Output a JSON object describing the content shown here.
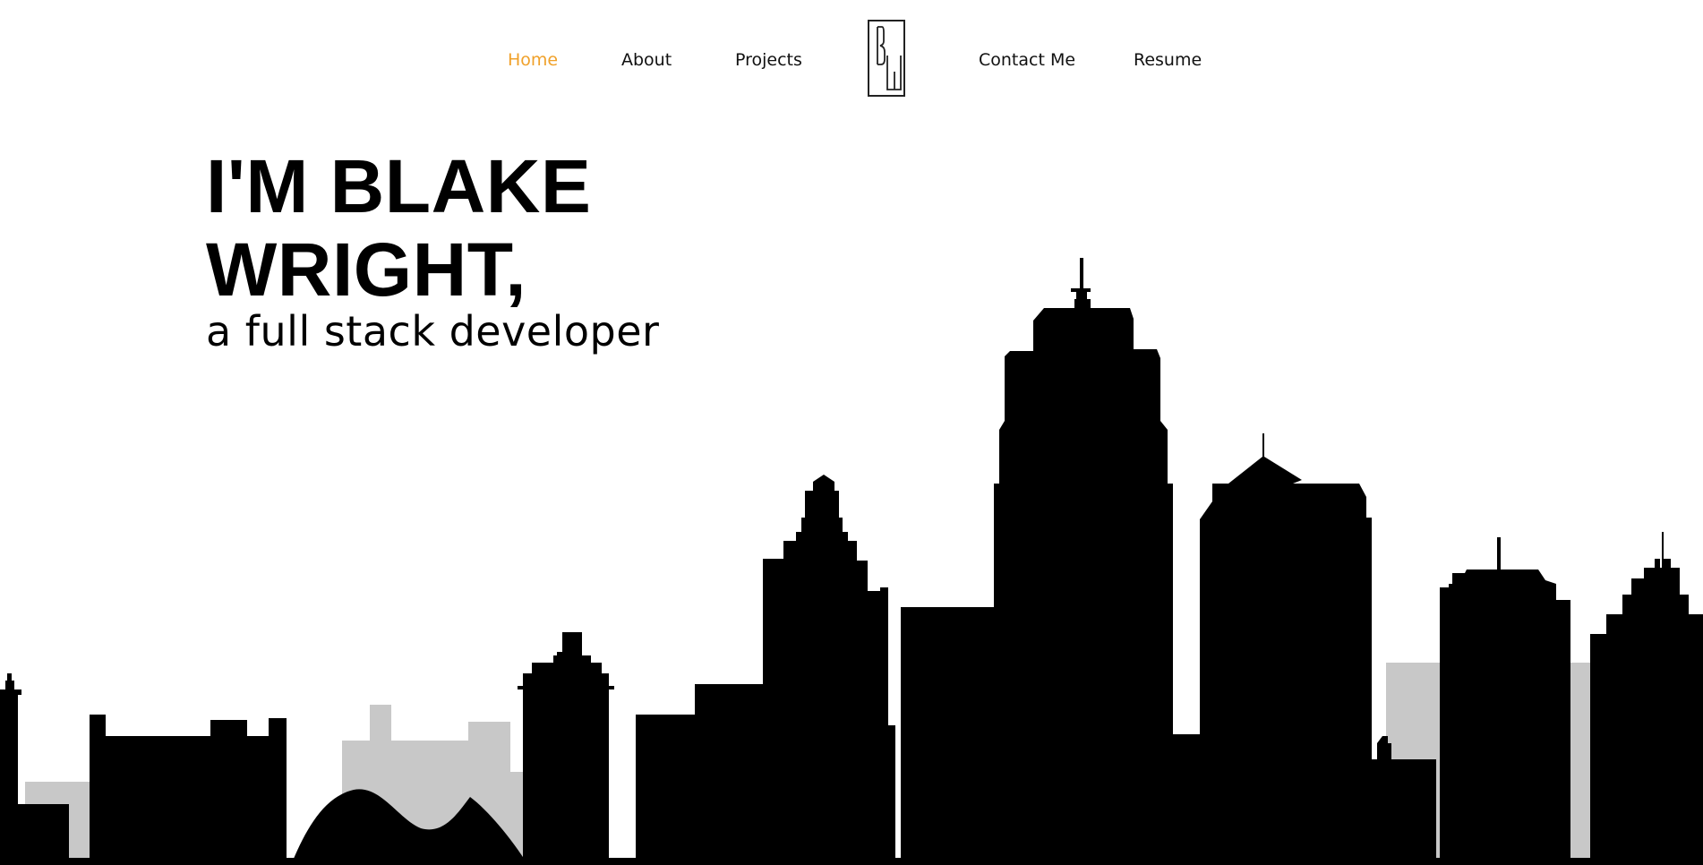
{
  "nav": {
    "items": [
      {
        "label": "Home",
        "active": true
      },
      {
        "label": "About",
        "active": false
      },
      {
        "label": "Projects",
        "active": false
      },
      {
        "label": "Contact Me",
        "active": false
      },
      {
        "label": "Resume",
        "active": false
      }
    ],
    "logo_letters": "BW",
    "active_color": "#f0a12a"
  },
  "hero": {
    "name_line1": "I'M BLAKE",
    "name_line2": "WRIGHT,",
    "subtitle": "a full stack developer"
  },
  "skyline": {
    "foreground_color": "#000000",
    "background_color": "#c8c8c8"
  }
}
